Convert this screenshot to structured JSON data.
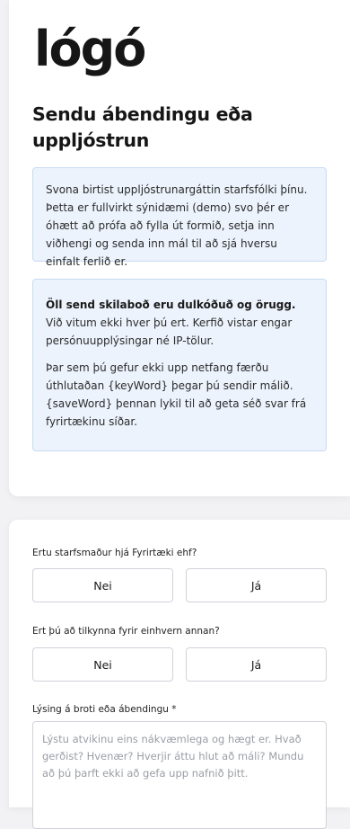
{
  "brand": {
    "logo_text": "lógó"
  },
  "intro": {
    "title": "Sendu ábendingu eða uppljóstrun",
    "demo_notice": "Svona birtist uppljóstrunargáttin starfsfólki þínu. Þetta er fullvirkt sýnidæmi (demo) svo þér er óhætt að prófa að fylla út formið, setja inn viðhengi og senda inn mál til að sjá hversu einfalt ferlið er.",
    "security_bold": "Öll send skilaboð eru dulkóðuð og örugg.",
    "security_text": " Við vitum ekki hver þú ert. Kerfið vistar engar persónuupplýsingar né IP-tölur.",
    "key_notice": "Þar sem þú gefur ekki upp netfang færðu úthlutaðan {keyWord} þegar þú sendir málið. {saveWord} þennan lykil til að geta séð svar frá fyrirtækinu síðar."
  },
  "form": {
    "q1": {
      "label": "Ertu starfsmaður hjá Fyrirtæki ehf?",
      "no": "Nei",
      "yes": "Já"
    },
    "q2": {
      "label": "Ert þú að tilkynna fyrir einhvern annan?",
      "no": "Nei",
      "yes": "Já"
    },
    "description": {
      "label": "Lýsing á broti eða ábendingu *",
      "placeholder": "Lýstu atvikinu eins nákvæmlega og hægt er. Hvað gerðist? Hvenær? Hverjir áttu hlut að máli? Mundu að þú þarft ekki að gefa upp nafnið þitt."
    }
  }
}
